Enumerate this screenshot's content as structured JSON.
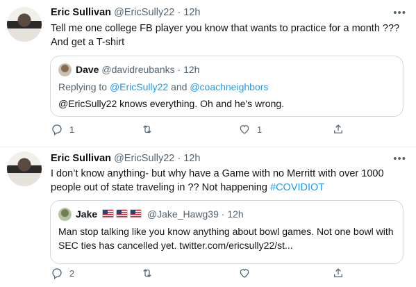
{
  "tweets": [
    {
      "author_name": "Eric Sullivan",
      "author_handle": "@EricSully22",
      "separator": "·",
      "time": "12h",
      "text": "Tell me one college FB player you know that wants to practice for a month ??? And  get a T-shirt",
      "quote": {
        "author_name": "Dave",
        "author_handle": "@davidreubanks",
        "separator": "·",
        "time": "12h",
        "replying_prefix": "Replying to",
        "replying_handle_1": "@EricSully22",
        "replying_and": "and",
        "replying_handle_2": "@coachneighbors",
        "text": "@EricSully22 knows everything.  Oh and he's wrong."
      },
      "actions": {
        "reply_count": "1",
        "retweet_count": "",
        "like_count": "1"
      }
    },
    {
      "author_name": "Eric Sullivan",
      "author_handle": "@EricSully22",
      "separator": "·",
      "time": "12h",
      "text": "I don’t know anything- but why have a Game with no Merritt with over 1000 people out of state traveling in ?? Not happening ",
      "hashtag": "#COVIDIOT",
      "quote": {
        "author_name": "Jake",
        "author_handle": "@Jake_Hawg39",
        "separator": "·",
        "time": "12h",
        "text": "Man stop talking like you know anything about bowl games. Not one bowl with SEC ties has cancelled yet. twitter.com/ericsully22/st..."
      },
      "actions": {
        "reply_count": "2",
        "retweet_count": "",
        "like_count": ""
      }
    }
  ],
  "icons": [
    "more-icon",
    "reply-icon",
    "retweet-icon",
    "like-icon",
    "share-icon",
    "us-flag-icon"
  ],
  "colors": {
    "link": "#1d9bf0",
    "muted": "#536471",
    "border": "#cfd9de"
  }
}
